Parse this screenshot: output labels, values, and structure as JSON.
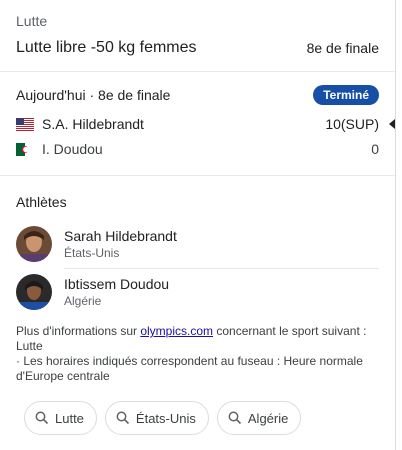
{
  "sport": "Lutte",
  "event": {
    "title": "Lutte libre -50 kg femmes",
    "round": "8e de finale"
  },
  "match": {
    "label": "Aujourd'hui · 8e de finale",
    "status": "Terminé",
    "competitors": [
      {
        "name": "S.A. Hildebrandt",
        "score": "10(SUP)",
        "flag": "usa-flag-icon"
      },
      {
        "name": "I. Doudou",
        "score": "0",
        "flag": "algeria-flag-icon"
      }
    ]
  },
  "athletes": {
    "title": "Athlètes",
    "items": [
      {
        "name": "Sarah Hildebrandt",
        "country": "États-Unis"
      },
      {
        "name": "Ibtissem Doudou",
        "country": "Algérie"
      }
    ]
  },
  "info": {
    "prefix": "Plus d'informations sur ",
    "link": "olympics.com",
    "suffix": " concernant le sport suivant : Lutte",
    "timezone": " · Les horaires indiqués correspondent au fuseau : Heure normale d'Europe centrale"
  },
  "chips": [
    "Lutte",
    "États-Unis",
    "Algérie"
  ],
  "colors": {
    "badge": "#174ea6",
    "link": "#1a0dab"
  }
}
